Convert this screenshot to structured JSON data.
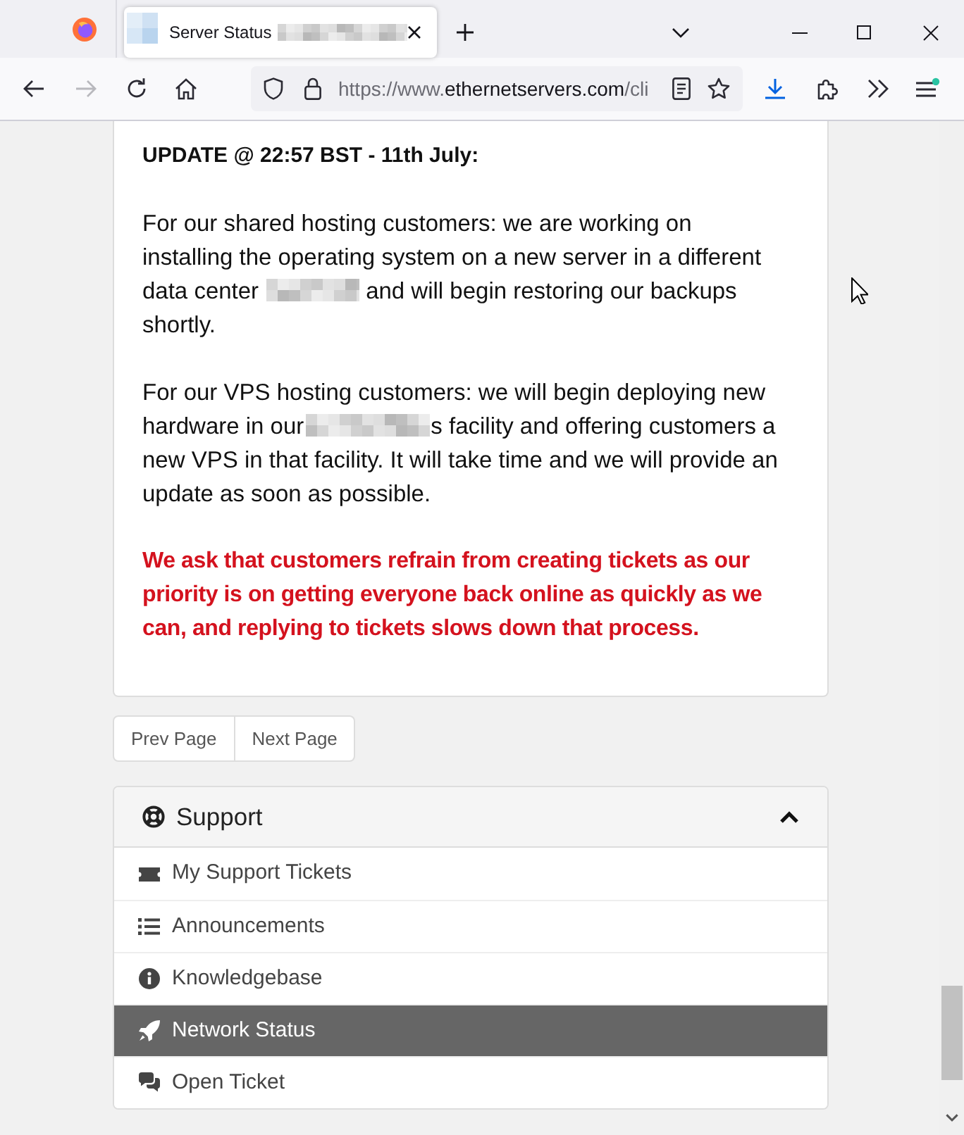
{
  "browser": {
    "tabs": [
      {
        "title": "Server Status",
        "title_redacted": true,
        "selected": true
      }
    ],
    "forward_disabled": true,
    "url": {
      "scheme": "https://www.",
      "host": "ethernetservers.com",
      "path": "/cli"
    }
  },
  "announcement": {
    "heading": "UPDATE @ 22:57 BST - 11th July:",
    "paragraphs": [
      {
        "kind": "normal",
        "parts": [
          {
            "kind": "text",
            "text": "For our shared hosting customers: we are working on installing the operating system on a new server in a different data center"
          },
          {
            "kind": "redacted"
          },
          {
            "kind": "text",
            "text": "and will begin restoring our backups shortly."
          }
        ]
      },
      {
        "kind": "normal",
        "parts": [
          {
            "kind": "text",
            "text": "For our VPS hosting customers: we will begin deploying new hardware in our"
          },
          {
            "kind": "redacted"
          },
          {
            "kind": "text",
            "text": "s facility and offering customers a new VPS in that facility. It will take time and we will provide an update as soon as possible."
          }
        ]
      },
      {
        "kind": "warning",
        "parts": [
          {
            "kind": "text",
            "text": "We ask that customers refrain from creating tickets as our priority is on getting everyone back online as quickly as we can, and replying to tickets slows down that process."
          }
        ]
      }
    ]
  },
  "pagination": [
    {
      "label": "Prev Page"
    },
    {
      "label": "Next Page"
    }
  ],
  "support_panel": {
    "title": "Support",
    "expanded": true,
    "items": [
      {
        "label": "My Support Tickets",
        "selected": false
      },
      {
        "label": "Announcements",
        "selected": false
      },
      {
        "label": "Knowledgebase",
        "selected": false
      },
      {
        "label": "Network Status",
        "selected": true
      },
      {
        "label": "Open Ticket",
        "selected": false
      }
    ]
  }
}
